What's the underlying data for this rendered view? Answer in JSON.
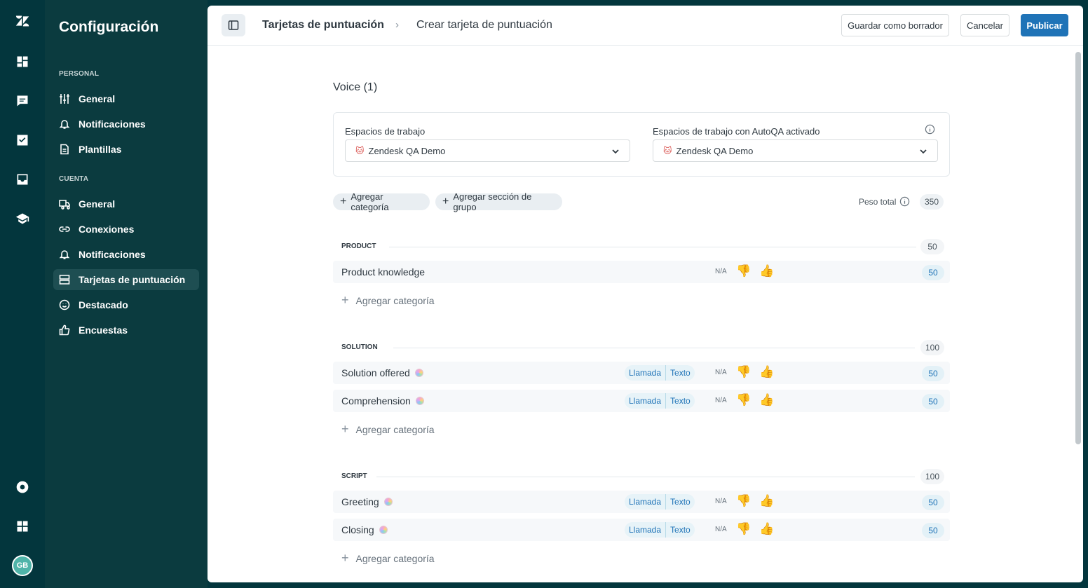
{
  "rail": {
    "avatar_initials": "GB",
    "items": [
      "dashboard-icon",
      "chat-icon",
      "checkbox-icon",
      "inbox-icon",
      "graduation-cap-icon"
    ],
    "bottom_items": [
      "help-icon",
      "apps-grid-icon"
    ]
  },
  "sidenav": {
    "title": "Configuración",
    "personal_label": "PERSONAL",
    "personal_items": [
      {
        "label": "General",
        "icon": "sliders-icon"
      },
      {
        "label": "Notificaciones",
        "icon": "bell-icon"
      },
      {
        "label": "Plantillas",
        "icon": "document-icon"
      }
    ],
    "account_label": "CUENTA",
    "account_items": [
      {
        "label": "General",
        "icon": "truck-icon"
      },
      {
        "label": "Conexiones",
        "icon": "link-icon"
      },
      {
        "label": "Notificaciones",
        "icon": "bell-icon"
      },
      {
        "label": "Tarjetas de puntuación",
        "icon": "scorecard-icon",
        "active": true
      },
      {
        "label": "Destacado",
        "icon": "smiley-icon"
      },
      {
        "label": "Encuestas",
        "icon": "thumbs-up-icon"
      }
    ]
  },
  "header": {
    "breadcrumb_parent": "Tarjetas de puntuación",
    "breadcrumb_sep": "›",
    "breadcrumb_current": "Crear tarjeta de puntuación",
    "draft_label": "Guardar como borrador",
    "cancel_label": "Cancelar",
    "publish_label": "Publicar"
  },
  "scorecard": {
    "title": "Voice (1)",
    "workspaces_label": "Espacios de trabajo",
    "workspaces_value": "Zendesk QA Demo",
    "autoqa_label": "Espacios de trabajo con AutoQA activado",
    "autoqa_value": "Zendesk QA Demo",
    "add_category_label": "Agregar categoría",
    "add_group_label": "Agregar sección de grupo",
    "total_weight_label": "Peso total",
    "total_weight": "350",
    "na_label": "N/A",
    "channel_call": "Llamada",
    "channel_text": "Texto",
    "groups": [
      {
        "name": "PRODUCT",
        "weight": "50",
        "categories": [
          {
            "name": "Product knowledge",
            "weight": "50",
            "autoqa": false,
            "channels": false
          }
        ]
      },
      {
        "name": "SOLUTION",
        "weight": "100",
        "categories": [
          {
            "name": "Solution offered",
            "weight": "50",
            "autoqa": true,
            "channels": true
          },
          {
            "name": "Comprehension",
            "weight": "50",
            "autoqa": true,
            "channels": true
          }
        ]
      },
      {
        "name": "SCRIPT",
        "weight": "100",
        "categories": [
          {
            "name": "Greeting",
            "weight": "50",
            "autoqa": true,
            "channels": true
          },
          {
            "name": "Closing",
            "weight": "50",
            "autoqa": true,
            "channels": true
          }
        ]
      }
    ]
  }
}
